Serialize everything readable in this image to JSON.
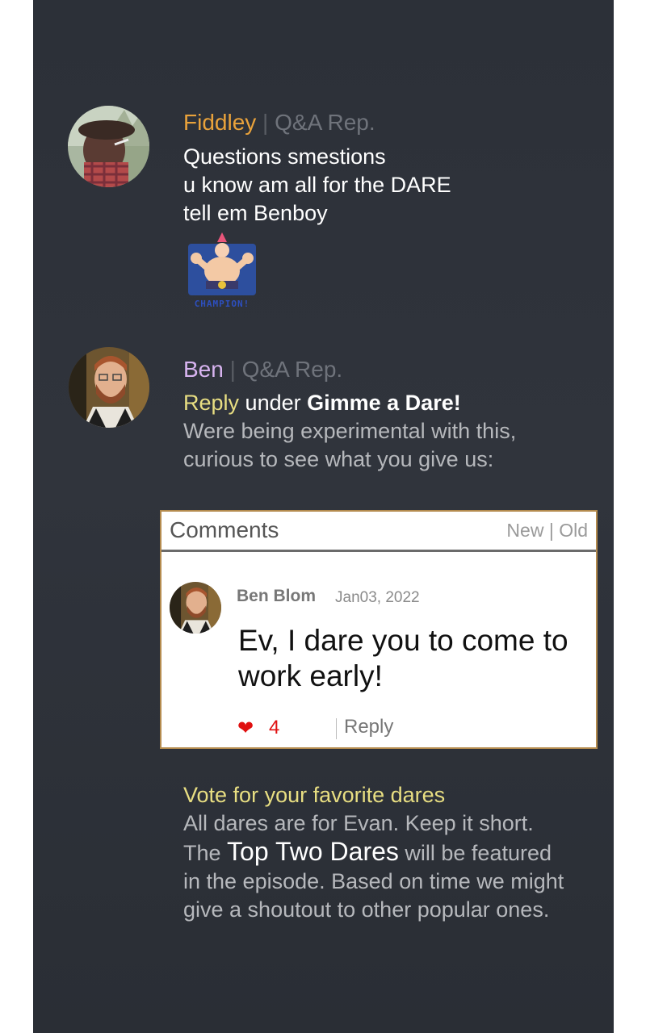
{
  "posts": [
    {
      "author": "Fiddley",
      "author_color": "#e9a23b",
      "role": "Q&A Rep.",
      "lines": [
        "Questions smestions",
        "u know am all for the DARE",
        "tell em Benboy"
      ],
      "sticker_text": "CHAMPION!"
    },
    {
      "author": "Ben",
      "author_color": "#d8b4f0",
      "role": "Q&A Rep.",
      "reply_label": "Reply",
      "under_label": "under",
      "thread_title": "Gimme a Dare!",
      "lines": [
        "Were being experimental with this,",
        "curious to see what you give us:"
      ]
    }
  ],
  "comments": {
    "title": "Comments",
    "sort_new": "New",
    "sort_old": "Old",
    "items": [
      {
        "author": "Ben Blom",
        "date": "Jan03, 2022",
        "text": "Ev, I dare you to come to work early!",
        "likes": "4",
        "reply_label": "Reply"
      }
    ]
  },
  "footer": {
    "heading": "Vote for your favorite dares",
    "line1": "All dares are for Evan. Keep it short.",
    "line2_pre": "The",
    "line2_highlight": "Top Two Dares",
    "line2_post": "will be featured",
    "line3": "in the episode. Based on time we might",
    "line4": "give a shoutout to other popular ones."
  },
  "icons": {
    "heart": "heart-icon"
  }
}
